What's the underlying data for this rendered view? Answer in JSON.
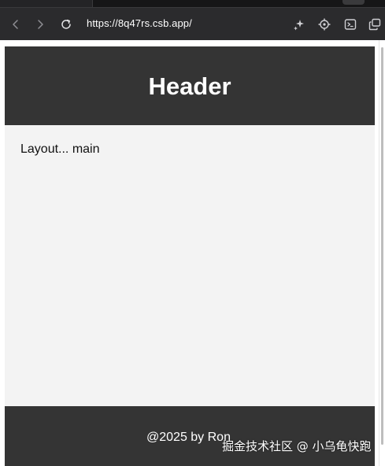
{
  "browser": {
    "url": "https://8q47rs.csb.app/",
    "icons": {
      "back": "chevron-left-icon",
      "forward": "chevron-right-icon",
      "reload": "reload-icon",
      "sparkle": "sparkle-icon",
      "target": "crosshair-icon",
      "terminal": "terminal-icon",
      "popout": "popout-window-icon"
    },
    "colors": {
      "toolbar_bg": "#2b2b2d",
      "tabstrip_bg": "#161617"
    }
  },
  "page": {
    "header_title": "Header",
    "main_text": "Layout... main",
    "footer_text": "@2025 by Ron",
    "colors": {
      "header_bg": "#343434",
      "main_bg": "#f3f3f3",
      "footer_bg": "#343434"
    }
  },
  "watermark": {
    "text": "掘金技术社区 @ 小乌龟快跑"
  }
}
